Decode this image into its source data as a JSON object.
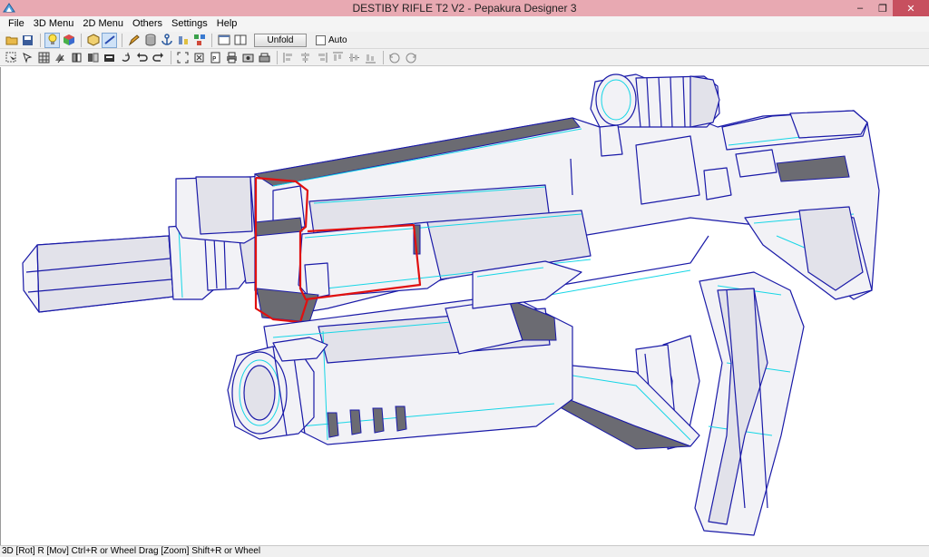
{
  "window": {
    "title": "DESTIBY RIFLE T2 V2 - Pepakura Designer 3",
    "controls": {
      "minimize": "‒",
      "maximize": "❐",
      "close": "✕"
    }
  },
  "menu": [
    "File",
    "3D Menu",
    "2D Menu",
    "Others",
    "Settings",
    "Help"
  ],
  "toolbar": {
    "unfold_label": "Unfold",
    "auto_label": "Auto",
    "auto_checked": false
  },
  "status": {
    "text": "3D [Rot] R [Mov] Ctrl+R or Wheel Drag [Zoom] Shift+R or Wheel"
  },
  "colors": {
    "titlebar": "#e8a9b2",
    "close": "#c7505f",
    "model_face": "#f2f2f6",
    "model_edge": "#1a1aa8",
    "fold_line": "#16d6e6",
    "selection": "#e01010",
    "shadow_face": "#6b6b72"
  }
}
